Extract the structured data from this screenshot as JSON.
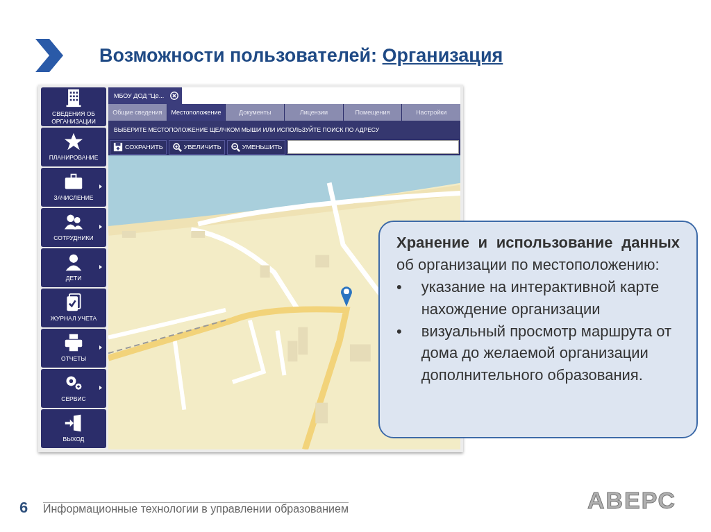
{
  "title": {
    "text": "Возможности пользователей:",
    "link": "Организация"
  },
  "sidebar": {
    "items": [
      {
        "kind": "building",
        "label": "СВЕДЕНИЯ ОБ ОРГАНИЗАЦИИ",
        "submenu": false
      },
      {
        "kind": "star",
        "label": "ПЛАНИРОВАНИЕ",
        "submenu": false
      },
      {
        "kind": "briefcase",
        "label": "ЗАЧИСЛЕНИЕ",
        "submenu": true
      },
      {
        "kind": "people",
        "label": "СОТРУДНИКИ",
        "submenu": true
      },
      {
        "kind": "person",
        "label": "ДЕТИ",
        "submenu": true
      },
      {
        "kind": "journal",
        "label": "ЖУРНАЛ УЧЕТА",
        "submenu": false
      },
      {
        "kind": "printer",
        "label": "ОТЧЕТЫ",
        "submenu": true
      },
      {
        "kind": "gears",
        "label": "СЕРВИС",
        "submenu": true
      },
      {
        "kind": "exit",
        "label": "ВЫХОД",
        "submenu": false
      }
    ]
  },
  "document_tab": {
    "label": "МБОУ ДОД \"Це...",
    "closable": true
  },
  "tabs": [
    {
      "label": "Общие сведения",
      "selected": false
    },
    {
      "label": "Местоположение",
      "selected": true
    },
    {
      "label": "Документы",
      "selected": false
    },
    {
      "label": "Лицензии",
      "selected": false
    },
    {
      "label": "Помещения",
      "selected": false
    },
    {
      "label": "Настройки",
      "selected": false
    }
  ],
  "hint": "ВЫБЕРИТЕ МЕСТОПОЛОЖЕНИЕ ЩЕЛЧКОМ МЫШИ ИЛИ ИСПОЛЬЗУЙТЕ ПОИСК ПО АДРЕСУ",
  "toolbar": [
    {
      "kind": "save",
      "label": "СОХРАНИТЬ"
    },
    {
      "kind": "zoom-in",
      "label": "УВЕЛИЧИТЬ"
    },
    {
      "kind": "zoom-out",
      "label": "УМЕНЬШИТЬ"
    }
  ],
  "callout": {
    "intro": "**Хранение и использование данных** об организации по местоположению:",
    "bullets": [
      {
        "mark": "•",
        "text": "указание на интерактивной карте нахождение организации"
      },
      {
        "mark": "•",
        "text": "визуальный просмотр маршрута от дома до желаемой организации дополнительного образования."
      }
    ]
  },
  "footer": {
    "page": "6",
    "text": "Информационные технологии в управлении образованием",
    "logo": "АВЕРС"
  }
}
